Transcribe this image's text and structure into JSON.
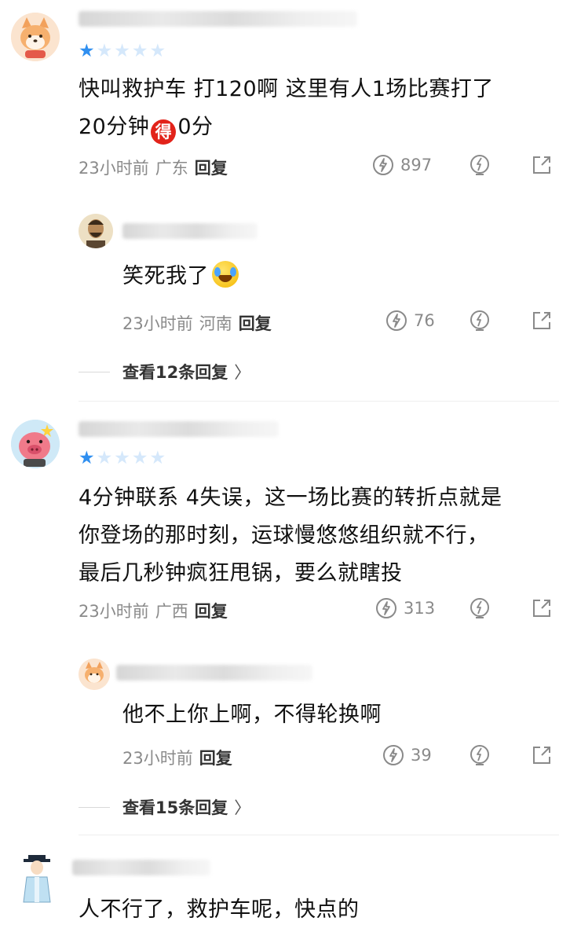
{
  "comments": [
    {
      "rating": 1,
      "text_parts": [
        "快叫救护车 打120啊 这里有人1场比赛打了",
        "20分钟",
        "得",
        "0分"
      ],
      "meta": {
        "time": "23小时前",
        "location": "广东",
        "reply": "回复"
      },
      "likes": "897",
      "reply": {
        "text": "笑死我了",
        "meta": {
          "time": "23小时前",
          "location": "河南",
          "reply": "回复"
        },
        "likes": "76"
      },
      "view_more": "查看12条回复"
    },
    {
      "rating": 1,
      "text_lines": [
        "4分钟联系 4失误，这一场比赛的转折点就是",
        "你登场的那时刻，运球慢悠悠组织就不行，",
        "最后几秒钟疯狂甩锅，要么就瞎投"
      ],
      "meta": {
        "time": "23小时前",
        "location": "广西",
        "reply": "回复"
      },
      "likes": "313",
      "reply": {
        "text": "他不上你上啊，不得轮换啊",
        "meta": {
          "time": "23小时前",
          "reply": "回复"
        },
        "likes": "39"
      },
      "view_more": "查看15条回复"
    },
    {
      "text": "人不行了，救护车呢，快点的"
    }
  ],
  "colors": {
    "accent_star": "#2f8ff0",
    "badge_red": "#e2231a",
    "meta_gray": "#8a8a8a"
  },
  "icons": [
    "like-icon",
    "dislike-icon",
    "share-icon",
    "chevron-right-icon"
  ]
}
